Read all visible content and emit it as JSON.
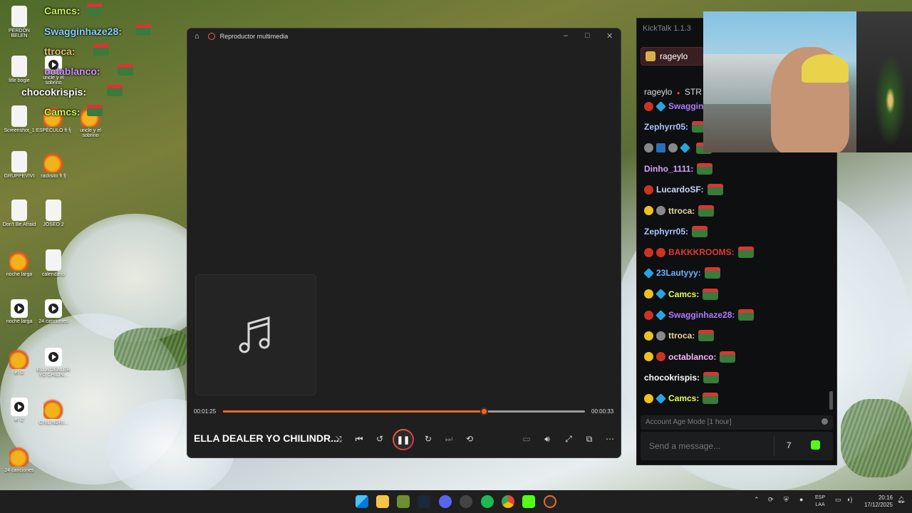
{
  "desktop": {
    "icons": [
      {
        "label": "PERDÓN BELEN",
        "kind": "doc"
      },
      {
        "label": "litle bogie",
        "kind": "doc"
      },
      {
        "label": "uncle y el sobrino",
        "kind": "video"
      },
      {
        "label": "Screenshot_1",
        "kind": "doc"
      },
      {
        "label": "ESPÉCULO ft fj",
        "kind": "fl"
      },
      {
        "label": "uncle y el sobrino",
        "kind": "fl"
      },
      {
        "label": "GRUPPEVIVI",
        "kind": "doc"
      },
      {
        "label": "racksito ft fj",
        "kind": "fl"
      },
      {
        "label": "Don't Be Afraid",
        "kind": "doc"
      },
      {
        "label": "JOSEO 2",
        "kind": "doc"
      },
      {
        "label": "noche larga",
        "kind": "fl"
      },
      {
        "label": "calendario",
        "kind": "doc"
      },
      {
        "label": "noche larga",
        "kind": "video"
      },
      {
        "label": "24 canciones",
        "kind": "video"
      },
      {
        "label": "el i2",
        "kind": "fl"
      },
      {
        "label": "ELLA DEALER YO CHILIN...",
        "kind": "video"
      },
      {
        "label": "el i2",
        "kind": "video"
      },
      {
        "label": "CHILINDRI...",
        "kind": "fl"
      },
      {
        "label": "24 canciones",
        "kind": "fl"
      }
    ],
    "overlay_chat": [
      {
        "user": "Camcs:",
        "color": "#c8f060"
      },
      {
        "user": "Swagginhaze28:",
        "color": "#8ad0ff"
      },
      {
        "user": "ttroca:",
        "color": "#e0c070"
      },
      {
        "user": "octablanco:",
        "color": "#d090ff"
      },
      {
        "user": "chocokrispis:",
        "color": "#ffffff"
      },
      {
        "user": "Camcs:",
        "color": "#c8f060"
      }
    ]
  },
  "player": {
    "window_title": "Reproductor multimedia",
    "elapsed": "00:01:25",
    "remaining": "00:00:33",
    "progress": 0.72,
    "track_title": "ELLA DEALER YO CHILINDR...",
    "state": "playing"
  },
  "kicktalk": {
    "app_title": "KickTalk 1.1.3",
    "tab_label": "rageylo",
    "stream_user": "rageylo",
    "stream_suffix": "STR",
    "messages": [
      {
        "user": "Swagginhaze28:",
        "color": "#b07cff",
        "badges": [
          "red",
          "cube"
        ]
      },
      {
        "user": "Zephyrr05:",
        "color": "#a9c4ff",
        "badges": []
      },
      {
        "user": "",
        "color": "#ffffff",
        "badges": [
          "gray",
          "sword",
          "gray",
          "cube"
        ]
      },
      {
        "user": "Dinho_1111:",
        "color": "#d8a4ff",
        "badges": []
      },
      {
        "user": "LucardoSF:",
        "color": "#c9d8ff",
        "badges": [
          "red"
        ]
      },
      {
        "user": "ttroca:",
        "color": "#e7d3a0",
        "badges": [
          "one",
          "gray"
        ]
      },
      {
        "user": "Zephyrr05:",
        "color": "#a9c4ff",
        "badges": []
      },
      {
        "user": "BAKKKROOMS:",
        "color": "#e33a32",
        "badges": [
          "red",
          "red"
        ]
      },
      {
        "user": "23Lautyyy:",
        "color": "#6fb2ff",
        "badges": [
          "cube"
        ]
      },
      {
        "user": "Camcs:",
        "color": "#e7ff4a",
        "badges": [
          "one",
          "cube"
        ]
      },
      {
        "user": "Swagginhaze28:",
        "color": "#b07cff",
        "badges": [
          "red",
          "cube"
        ]
      },
      {
        "user": "ttroca:",
        "color": "#e7d3a0",
        "badges": [
          "one",
          "gray"
        ]
      },
      {
        "user": "octablanco:",
        "color": "#ffb6ff",
        "badges": [
          "one",
          "red"
        ]
      },
      {
        "user": "chocokrispis:",
        "color": "#ffffff",
        "badges": []
      },
      {
        "user": "Camcs:",
        "color": "#e7ff4a",
        "badges": [
          "one",
          "cube"
        ]
      }
    ],
    "account_mode": "Account Age Mode [1 hour]",
    "input_placeholder": "Send a message..."
  },
  "taskbar": {
    "lang_top": "ESP",
    "lang_bottom": "LAA",
    "time": "20:16",
    "date": "17/12/2025"
  }
}
